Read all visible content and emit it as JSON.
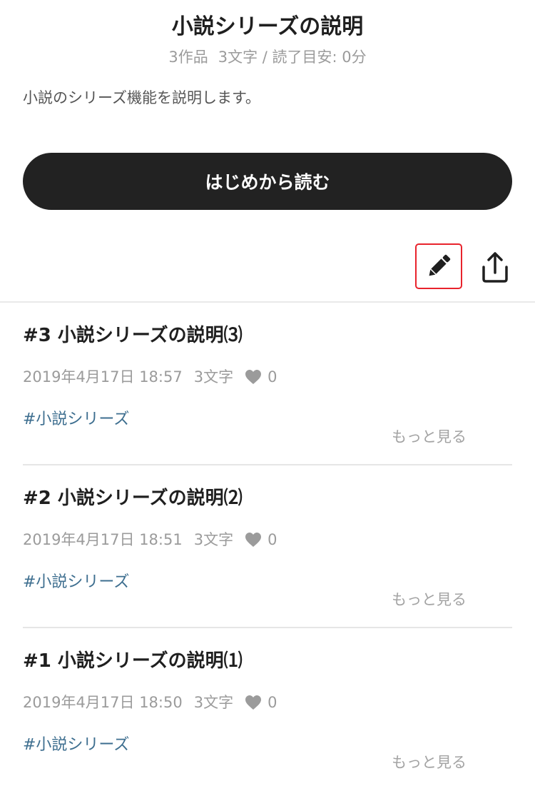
{
  "series": {
    "title": "小説シリーズの説明",
    "works": "3作品",
    "stats": "3文字 / 読了目安: 0分",
    "description": "小説のシリーズ機能を説明します。",
    "read_button": "はじめから読む"
  },
  "toolbar": {
    "edit_icon": "pencil-icon",
    "share_icon": "share-icon"
  },
  "colors": {
    "button_bg": "#222222",
    "tag": "#3d6e8f",
    "edit_highlight": "#e8232c",
    "muted": "#9b9b9b"
  },
  "episodes": [
    {
      "title": "#3 小説シリーズの説明⑶",
      "date": "2019年4月17日 18:57",
      "chars": "3文字",
      "likes": "0",
      "tag": "#小説シリーズ",
      "more": "もっと見る"
    },
    {
      "title": "#2 小説シリーズの説明⑵",
      "date": "2019年4月17日 18:51",
      "chars": "3文字",
      "likes": "0",
      "tag": "#小説シリーズ",
      "more": "もっと見る"
    },
    {
      "title": "#1 小説シリーズの説明⑴",
      "date": "2019年4月17日 18:50",
      "chars": "3文字",
      "likes": "0",
      "tag": "#小説シリーズ",
      "more": "もっと見る"
    }
  ]
}
